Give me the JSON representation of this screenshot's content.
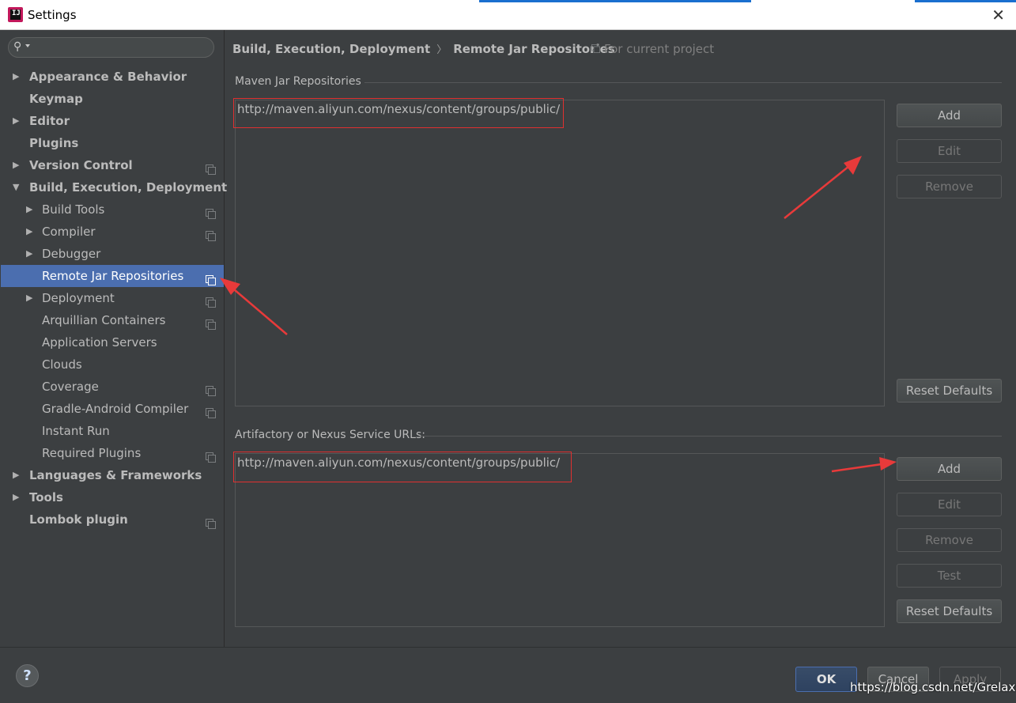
{
  "window": {
    "title": "Settings",
    "close_glyph": "✕",
    "app_icon_letters": "IJ"
  },
  "search": {
    "icon": "search-icon"
  },
  "sidebar": {
    "items": [
      {
        "label": "Appearance & Behavior",
        "bold": true,
        "expandable": true,
        "expanded": false
      },
      {
        "label": "Keymap",
        "bold": true
      },
      {
        "label": "Editor",
        "bold": true,
        "expandable": true,
        "expanded": false
      },
      {
        "label": "Plugins",
        "bold": true
      },
      {
        "label": "Version Control",
        "bold": true,
        "expandable": true,
        "expanded": false,
        "project_icon": true
      },
      {
        "label": "Build, Execution, Deployment",
        "bold": true,
        "expandable": true,
        "expanded": true
      },
      {
        "label": "Build Tools",
        "expandable": true,
        "expanded": false,
        "project_icon": true
      },
      {
        "label": "Compiler",
        "expandable": true,
        "expanded": false,
        "project_icon": true
      },
      {
        "label": "Debugger",
        "expandable": true,
        "expanded": false
      },
      {
        "label": "Remote Jar Repositories",
        "selected": true,
        "project_icon": true
      },
      {
        "label": "Deployment",
        "expandable": true,
        "expanded": false,
        "project_icon": true
      },
      {
        "label": "Arquillian Containers",
        "project_icon": true
      },
      {
        "label": "Application Servers"
      },
      {
        "label": "Clouds"
      },
      {
        "label": "Coverage",
        "project_icon": true
      },
      {
        "label": "Gradle-Android Compiler",
        "project_icon": true
      },
      {
        "label": "Instant Run"
      },
      {
        "label": "Required Plugins",
        "project_icon": true
      },
      {
        "label": "Languages & Frameworks",
        "bold": true,
        "expandable": true,
        "expanded": false
      },
      {
        "label": "Tools",
        "bold": true,
        "expandable": true,
        "expanded": false
      },
      {
        "label": "Lombok plugin",
        "bold": true,
        "project_icon": true
      }
    ]
  },
  "breadcrumb": {
    "parent": "Build, Execution, Deployment",
    "separator": "〉",
    "current": "Remote Jar Repositories",
    "scope": "For current project"
  },
  "maven": {
    "title": "Maven Jar Repositories",
    "items": [
      "http://maven.aliyun.com/nexus/content/groups/public/"
    ],
    "buttons": {
      "add": "Add",
      "edit": "Edit",
      "remove": "Remove",
      "reset": "Reset Defaults"
    }
  },
  "artifactory": {
    "title": "Artifactory or Nexus Service URLs:",
    "items": [
      "http://maven.aliyun.com/nexus/content/groups/public/"
    ],
    "buttons": {
      "add": "Add",
      "edit": "Edit",
      "remove": "Remove",
      "test": "Test",
      "reset": "Reset Defaults"
    }
  },
  "footer": {
    "help": "?",
    "ok": "OK",
    "cancel": "Cancel",
    "apply": "Apply",
    "watermark": "https://blog.csdn.net/Grelaxs"
  },
  "colors": {
    "background": "#3c3f41",
    "selection": "#4b6eaf",
    "annotation_red": "#e03030"
  }
}
